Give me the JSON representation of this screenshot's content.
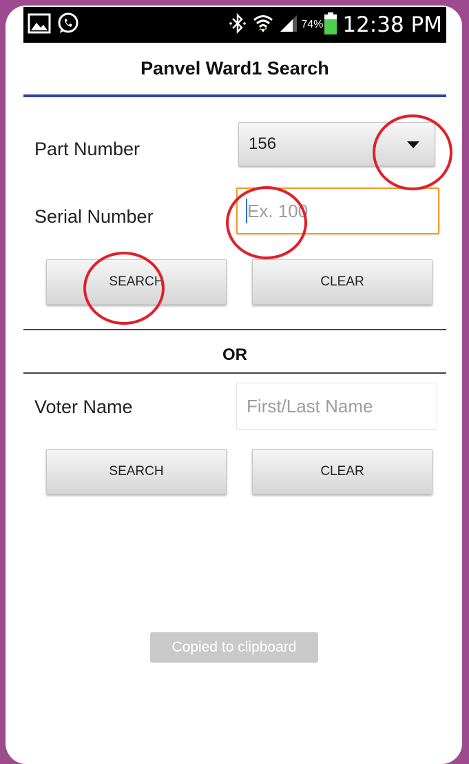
{
  "status_bar": {
    "battery": "74%",
    "time": "12:38 PM",
    "icons": [
      "gallery-icon",
      "whatsapp-icon",
      "bluetooth-icon",
      "wifi-icon",
      "signal-icon",
      "battery-icon"
    ]
  },
  "app": {
    "title": "Panvel Ward1 Search"
  },
  "part_number": {
    "label": "Part Number",
    "selected_value": "156"
  },
  "serial_number": {
    "label": "Serial Number",
    "placeholder": "Ex. 100",
    "value": ""
  },
  "serial_search": {
    "search_label": "SEARCH",
    "clear_label": "CLEAR"
  },
  "divider": {
    "or_label": "OR"
  },
  "voter_name": {
    "label": "Voter Name",
    "placeholder": "First/Last Name",
    "value": ""
  },
  "name_search": {
    "search_label": "SEARCH",
    "clear_label": "CLEAR"
  },
  "toast": {
    "message": "Copied to clipboard"
  },
  "colors": {
    "frame": "#9d4a8e",
    "title_rule": "#2e4598",
    "focus_border": "#f29a2e",
    "annotation": "#e0202a",
    "battery": "#4fd04a"
  }
}
